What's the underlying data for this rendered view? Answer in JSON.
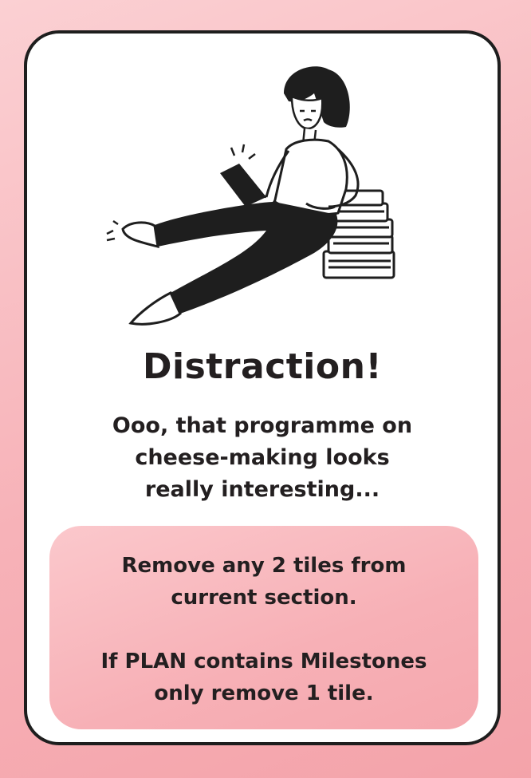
{
  "card": {
    "title": "Distraction!",
    "flavor_lines": [
      "Ooo, that programme on",
      "cheese-making looks",
      "really interesting..."
    ],
    "rule_lines": [
      "Remove any 2 tiles from",
      "current section."
    ],
    "condition_lines": [
      "If PLAN contains Milestones",
      "only remove 1 tile."
    ],
    "illustration_icon": "woman-reading-phone-illustration"
  },
  "colors": {
    "background": "#f7b2b8",
    "card": "#ffffff",
    "border": "#1e1e1e",
    "rule_box": "#f7b0b6",
    "text": "#231f20"
  }
}
